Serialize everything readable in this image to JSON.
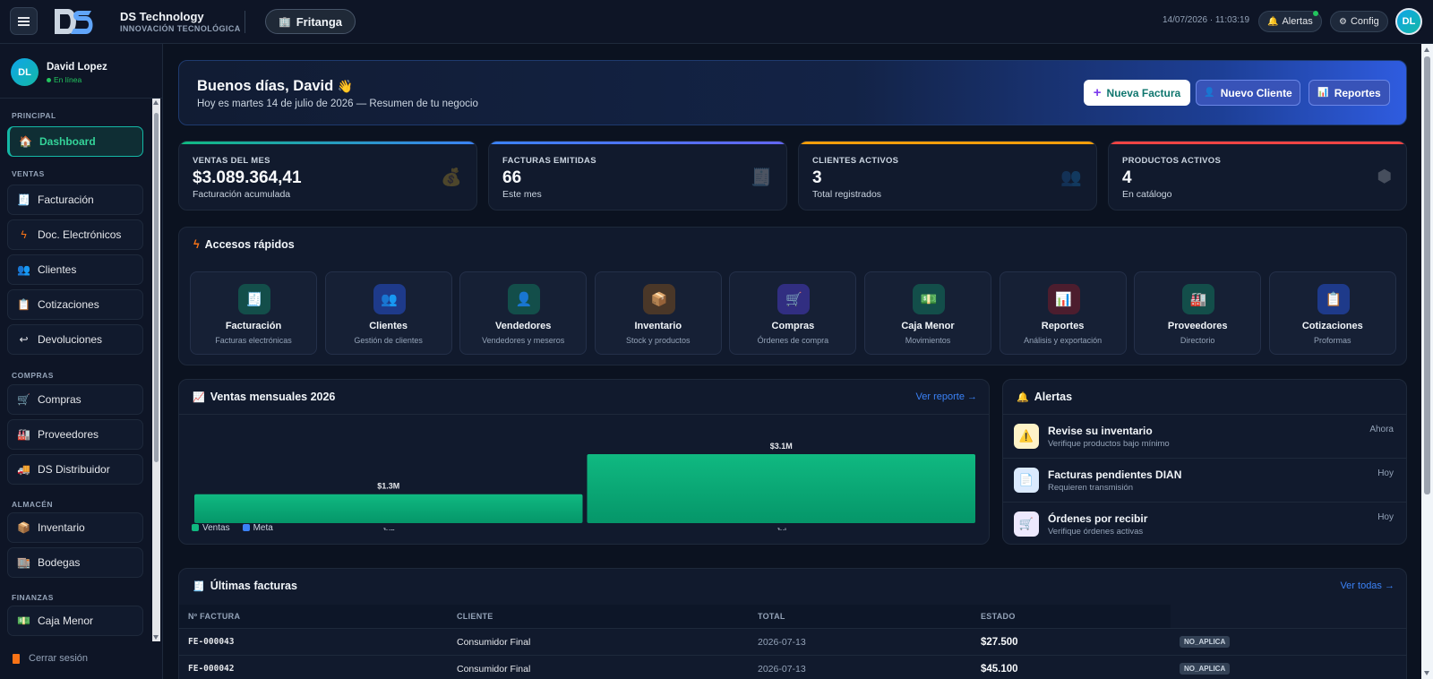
{
  "header": {
    "brand_name": "DS Technology",
    "brand_sub": "INNOVACIÓN TECNOLÓGICA",
    "store": "Fritanga",
    "datetime": "14/07/2026 · 11:03:19",
    "alerts_label": "Alertas",
    "config_label": "Config",
    "avatar": "DL"
  },
  "user": {
    "initials": "DL",
    "name": "David Lopez",
    "status": "En línea"
  },
  "sidebar": {
    "sections": {
      "principal": "PRINCIPAL",
      "ventas": "VENTAS",
      "compras": "COMPRAS",
      "almacen": "ALMACÉN",
      "finanzas": "FINANZAS"
    },
    "items": [
      {
        "label": "Dashboard",
        "icon": "home-icon"
      },
      {
        "label": "Facturación",
        "icon": "invoice-icon"
      },
      {
        "label": "Doc. Electrónicos",
        "icon": "lightning-icon"
      },
      {
        "label": "Clientes",
        "icon": "users-icon"
      },
      {
        "label": "Cotizaciones",
        "icon": "clipboard-icon"
      },
      {
        "label": "Devoluciones",
        "icon": "return-icon"
      },
      {
        "label": "Compras",
        "icon": "cart-icon"
      },
      {
        "label": "Proveedores",
        "icon": "factory-icon"
      },
      {
        "label": "DS Distribuidor",
        "icon": "truck-icon"
      },
      {
        "label": "Inventario",
        "icon": "box-icon"
      },
      {
        "label": "Bodegas",
        "icon": "warehouse-icon"
      },
      {
        "label": "Caja Menor",
        "icon": "cash-icon"
      }
    ],
    "logout": "Cerrar sesión"
  },
  "welcome": {
    "title": "Buenos días, David",
    "emoji": "👋",
    "subtitle": "Hoy es martes 14 de julio de 2026 — Resumen de tu negocio",
    "btn_new_invoice": "Nueva Factura",
    "btn_new_client": "Nuevo Cliente",
    "btn_reports": "Reportes"
  },
  "stats": [
    {
      "label": "VENTAS DEL MES",
      "value": "$3.089.364,41",
      "sub": "Facturación acumulada",
      "color": "#10b981",
      "color2": "#3b82f6",
      "icon": "money-bag-icon"
    },
    {
      "label": "FACTURAS EMITIDAS",
      "value": "66",
      "sub": "Este mes",
      "color": "#3b82f6",
      "color2": "#6366f1",
      "icon": "receipt-icon"
    },
    {
      "label": "CLIENTES ACTIVOS",
      "value": "3",
      "sub": "Total registrados",
      "color": "#f59e0b",
      "color2": "#f59e0b",
      "icon": "users-icon"
    },
    {
      "label": "PRODUCTOS ACTIVOS",
      "value": "4",
      "sub": "En catálogo",
      "color": "#ef4444",
      "color2": "#ef4444",
      "icon": "cube-icon"
    }
  ],
  "quick": {
    "title": "Accesos rápidos",
    "tiles": [
      {
        "name": "Facturación",
        "desc": "Facturas electrónicas",
        "icon": "invoice-icon",
        "bg": "#134e4a"
      },
      {
        "name": "Clientes",
        "desc": "Gestión de clientes",
        "icon": "users-icon",
        "bg": "#1e3a8a"
      },
      {
        "name": "Vendedores",
        "desc": "Vendedores y meseros",
        "icon": "user-icon",
        "bg": "#134e4a"
      },
      {
        "name": "Inventario",
        "desc": "Stock y productos",
        "icon": "box-icon",
        "bg": "#4a3728"
      },
      {
        "name": "Compras",
        "desc": "Órdenes de compra",
        "icon": "cart-icon",
        "bg": "#312e81"
      },
      {
        "name": "Caja Menor",
        "desc": "Movimientos",
        "icon": "cash-icon",
        "bg": "#134e4a"
      },
      {
        "name": "Reportes",
        "desc": "Análisis y exportación",
        "icon": "bar-chart-icon",
        "bg": "#4c1d2e"
      },
      {
        "name": "Proveedores",
        "desc": "Directorio",
        "icon": "factory-icon",
        "bg": "#134e4a"
      },
      {
        "name": "Cotizaciones",
        "desc": "Proformas",
        "icon": "clipboard-icon",
        "bg": "#1e3a8a"
      }
    ]
  },
  "chart_card": {
    "title": "Ventas mensuales 2026",
    "link": "Ver reporte →"
  },
  "chart_data": {
    "type": "bar",
    "title": "Ventas mensuales 2026",
    "categories": [
      "Jun",
      "Jul"
    ],
    "series": [
      {
        "name": "Ventas",
        "values": [
          1.3,
          3.1
        ],
        "labels": [
          "$1.3M",
          "$3.1M"
        ],
        "color": "#10b981"
      },
      {
        "name": "Meta",
        "values": [],
        "color": "#3b82f6"
      }
    ],
    "ylim": [
      0,
      3.1
    ],
    "grid": false,
    "legend": "bottom-left"
  },
  "alerts_card": {
    "title": "Alertas",
    "items": [
      {
        "title": "Revise su inventario",
        "sub": "Verifique productos bajo mínimo",
        "time": "Ahora",
        "icon": "warning-icon",
        "bg": "#fef3c7"
      },
      {
        "title": "Facturas pendientes DIAN",
        "sub": "Requieren transmisión",
        "time": "Hoy",
        "icon": "document-icon",
        "bg": "#dbeafe"
      },
      {
        "title": "Órdenes por recibir",
        "sub": "Verifique órdenes activas",
        "time": "Hoy",
        "icon": "cart-icon",
        "bg": "#ede9fe"
      }
    ]
  },
  "invoices": {
    "title": "Últimas facturas",
    "link": "Ver todas →",
    "columns": [
      "Nº FACTURA",
      "CLIENTE",
      "TOTAL",
      "ESTADO"
    ],
    "rows": [
      {
        "number": "FE-000043",
        "client": "Consumidor Final",
        "date": "2026-07-13",
        "total": "$27.500",
        "status": "NO_APLICA"
      },
      {
        "number": "FE-000042",
        "client": "Consumidor Final",
        "date": "2026-07-13",
        "total": "$45.100",
        "status": "NO_APLICA"
      }
    ]
  }
}
